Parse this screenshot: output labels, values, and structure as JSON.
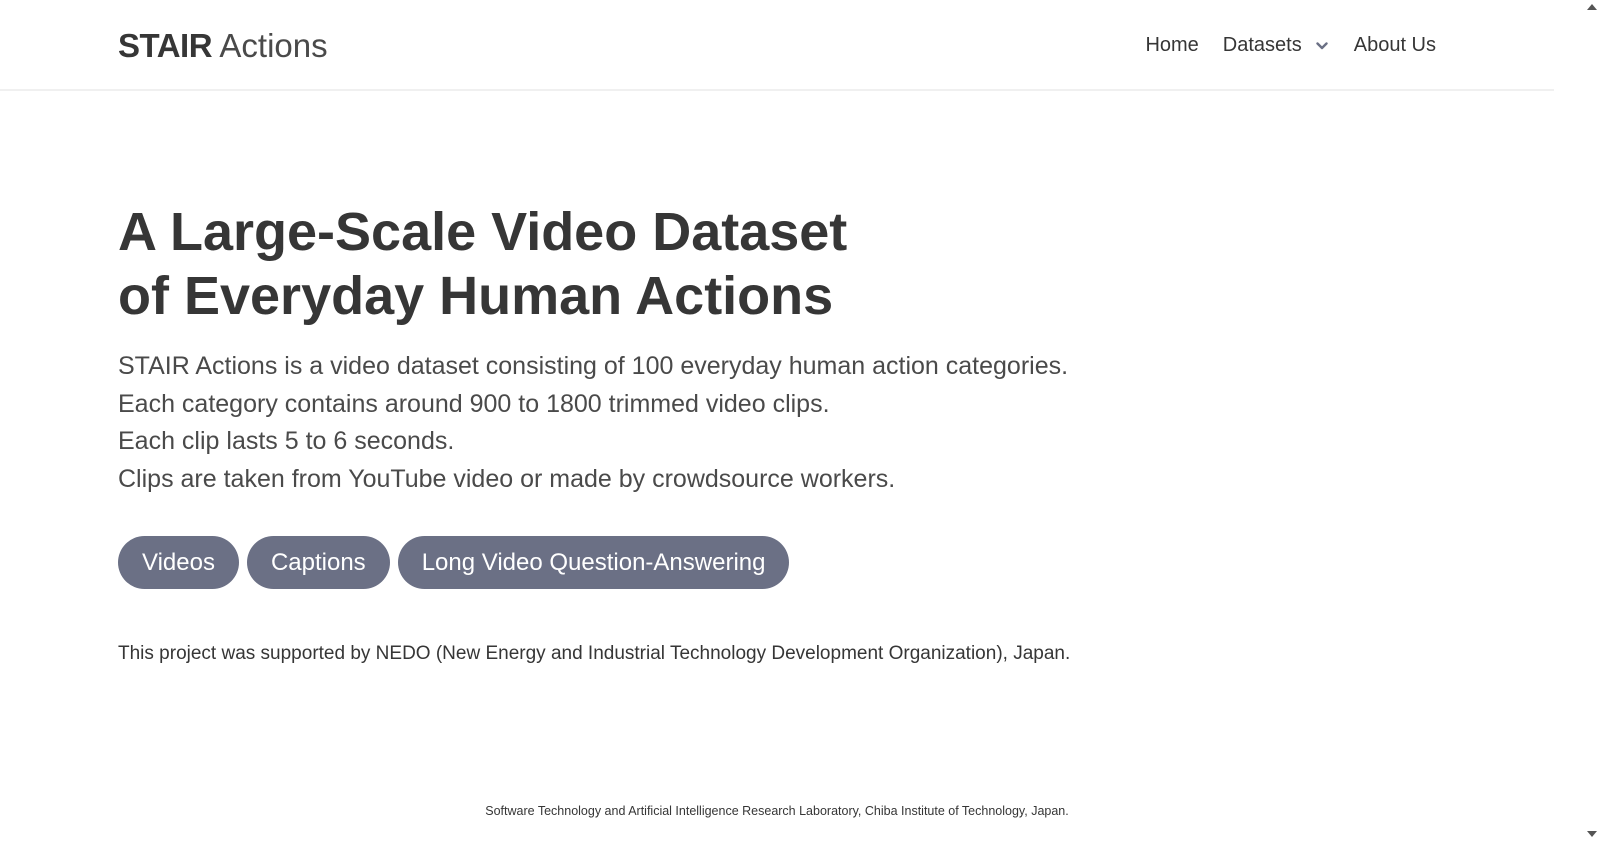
{
  "header": {
    "brand_bold": "STAIR",
    "brand_light": "Actions",
    "nav": {
      "home": "Home",
      "datasets": "Datasets",
      "datasets_icon": "chevron-down-icon",
      "about": "About Us"
    }
  },
  "hero": {
    "title": "A Large-Scale Video Dataset of Everyday Human Actions",
    "description": [
      "STAIR Actions is a video dataset consisting of 100 everyday human action categories.",
      "Each category contains around 900 to 1800 trimmed video clips.",
      "Each clip lasts 5 to 6 seconds.",
      "Clips are taken from YouTube video or made by crowdsource workers."
    ],
    "buttons": {
      "videos": "Videos",
      "captions": "Captions",
      "long_video_qa": "Long Video Question-Answering"
    },
    "button_color": "#6b7085"
  },
  "support": "This project was supported by NEDO (New Energy and Industrial Technology Development Organization), Japan.",
  "footer": "Software Technology and Artificial Intelligence Research Laboratory, Chiba Institute of Technology, Japan."
}
